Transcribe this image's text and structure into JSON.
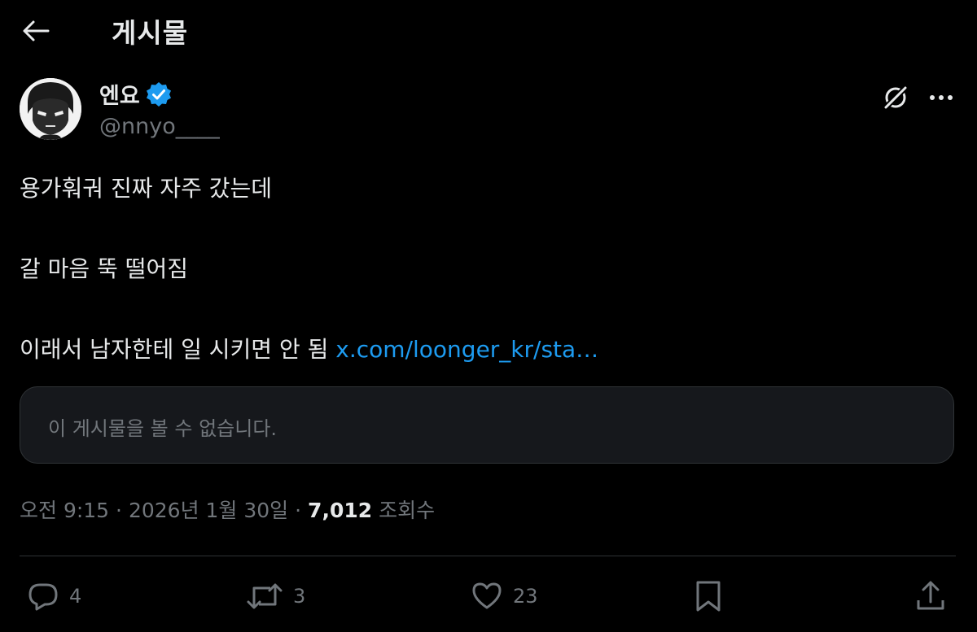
{
  "header": {
    "title": "게시물",
    "back_icon": "arrow-left-icon"
  },
  "author": {
    "display_name": "엔요",
    "handle": "@nnyo____",
    "verified_color": "#1d9bf0",
    "verified_icon": "verified-badge-icon",
    "avatar_icon": "cartoon-face-avatar"
  },
  "tweet": {
    "line1": "용가훠궈 진짜 자주 갔는데",
    "line2": "갈 마음 뚝 떨어짐",
    "line3_text": "이래서 남자한테 일 시키면 안 됨",
    "link_text": "x.com/loonger_kr/sta…",
    "link_color": "#1d9bf0"
  },
  "quoted": {
    "unavailable_text": "이 게시물을 볼 수 없습니다."
  },
  "meta": {
    "time": "오전 9:15",
    "date": "2026년 1월 30일",
    "separator": "·",
    "views": "7,012",
    "views_label": "조회수"
  },
  "actions": {
    "reply_count": "4",
    "retweet_count": "3",
    "like_count": "23",
    "icons": [
      "reply-icon",
      "retweet-icon",
      "like-icon",
      "bookmark-icon",
      "share-icon"
    ]
  },
  "colors": {
    "background": "#000000",
    "text_primary": "#e7e9ea",
    "text_secondary": "#71767b",
    "border": "#2f3336",
    "accent": "#1d9bf0"
  }
}
